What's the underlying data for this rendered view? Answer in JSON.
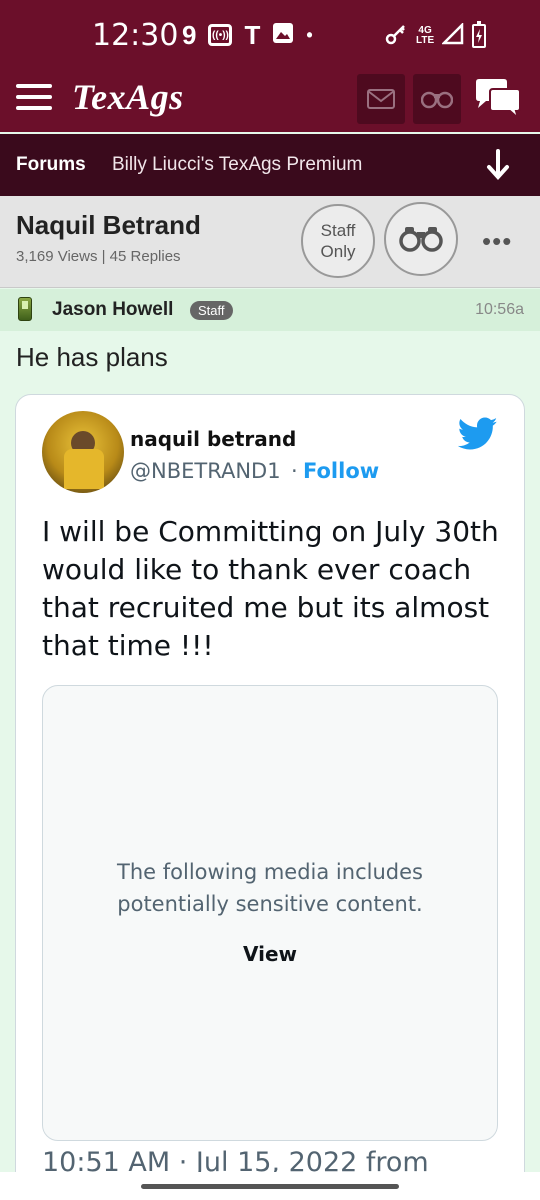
{
  "status_bar": {
    "time": "12:30",
    "notif_icons": [
      "nine-icon",
      "radio-icon",
      "t-mobile-icon",
      "image-icon",
      "dot-icon"
    ],
    "network_label_top": "4G",
    "network_label_bottom": "LTE"
  },
  "app_bar": {
    "logo": "TexAgs",
    "brand_color": "#6b0f2a"
  },
  "breadcrumb": {
    "forums": "Forums",
    "board": "Billy Liucci's TexAgs Premium"
  },
  "thread": {
    "title": "Naquil Betrand",
    "stats": "3,169 Views | 45 Replies",
    "staff_only_line1": "Staff",
    "staff_only_line2": "Only",
    "more": "•••"
  },
  "post": {
    "author": "Jason Howell",
    "badge": "Staff",
    "time": "10:56a",
    "text": "He has plans"
  },
  "tweet": {
    "name": "naquil betrand",
    "handle": "@NBETRAND1",
    "dot": "·",
    "follow": "Follow",
    "text": "I will be Committing on July 30th would like to thank ever coach that recruited me but its almost that time !!!",
    "media_message": "The following media includes potentially sensitive content.",
    "media_view": "View",
    "date": "10:51 AM · Jul 15, 2022 from",
    "accent_color": "#1d9bf0"
  }
}
